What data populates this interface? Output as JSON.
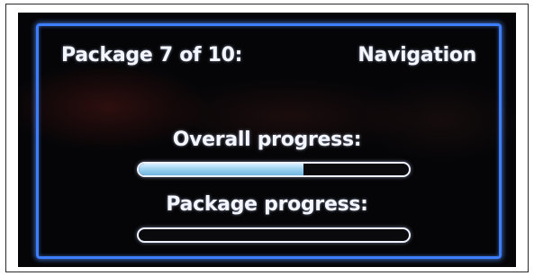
{
  "header": {
    "title": "Package 7 of 10:",
    "app_name": "Navigation"
  },
  "progress": {
    "overall_label": "Overall progress:",
    "overall_fraction": 0.61,
    "package_label": "Package progress:",
    "package_fraction": 0.0
  },
  "colors": {
    "frame_accent": "#3d7dff",
    "text": "#f4f6ff",
    "bar_fill": "#9fd2f0",
    "background": "#050507"
  }
}
